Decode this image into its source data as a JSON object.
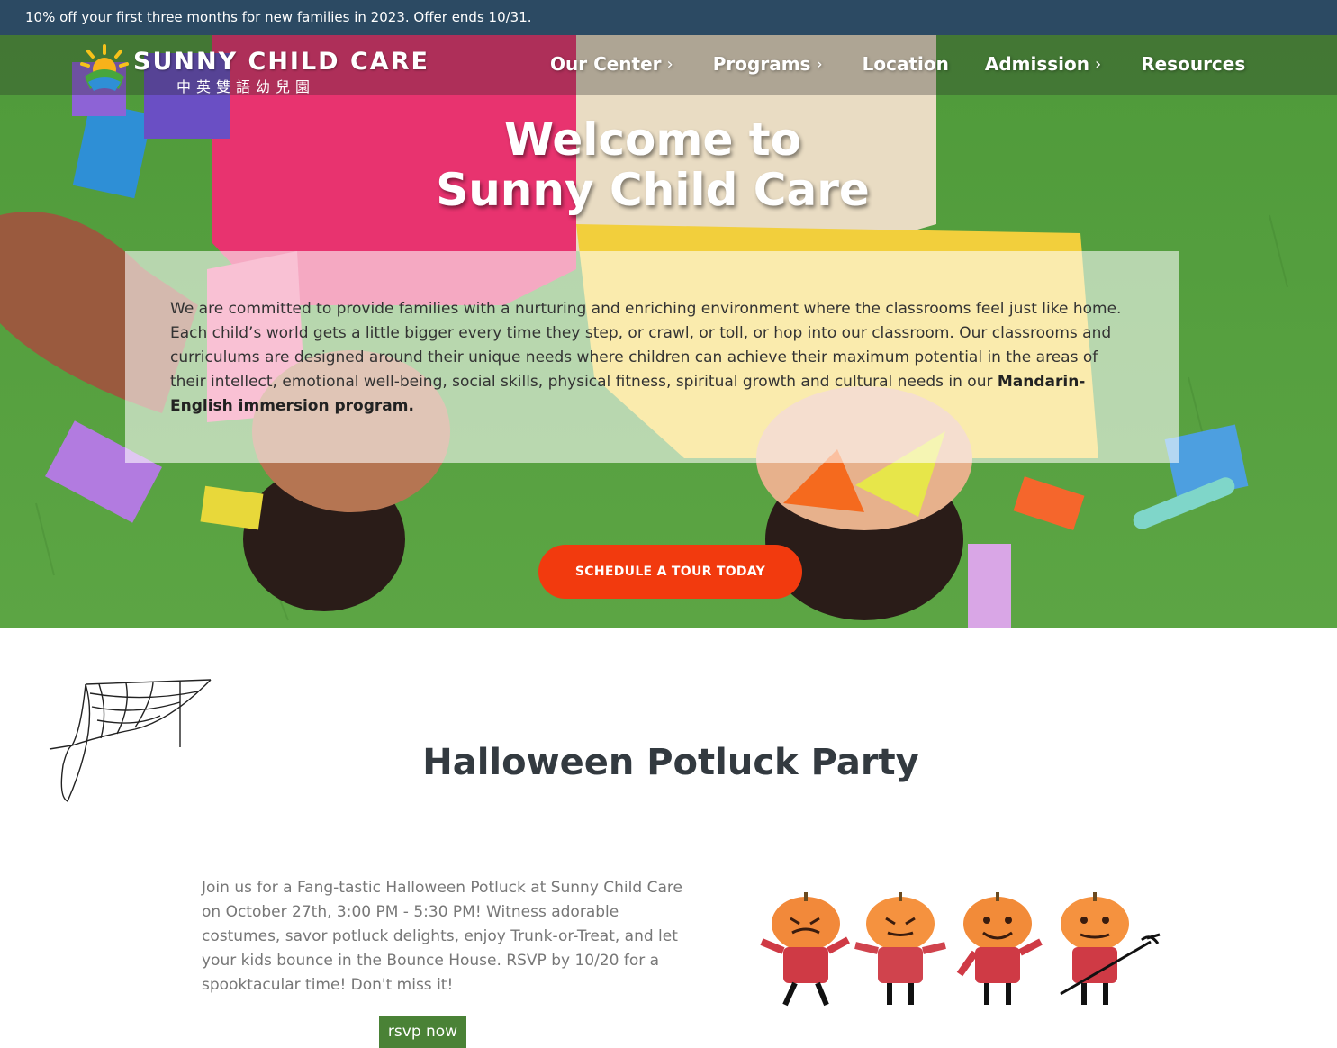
{
  "announcement": "10% off your first three months for new families in 2023. Offer ends 10/31.",
  "brand": {
    "name": "SUNNY CHILD CARE",
    "subtitle": "中英雙語幼兒園"
  },
  "nav": {
    "items": [
      {
        "label": "Our Center",
        "has_submenu": true
      },
      {
        "label": "Programs",
        "has_submenu": true
      },
      {
        "label": "Location",
        "has_submenu": false
      },
      {
        "label": "Admission",
        "has_submenu": true
      },
      {
        "label": "Resources",
        "has_submenu": false
      }
    ],
    "chevron_icon": "chevron-right-icon"
  },
  "hero": {
    "title_line1": "Welcome to",
    "title_line2": "Sunny Child Care",
    "intro_text": "We are committed to provide families with a nurturing and enriching environment where the classrooms feel just like home. Each child’s world gets a little bigger every time they step, or crawl, or toll, or hop into our classroom. Our classrooms and curriculums are designed around their unique needs where children can achieve their maximum potential in the areas of their intellect, emotional well-being, social skills, physical fitness, spiritual growth and cultural needs in our ",
    "intro_emphasis": "Mandarin-English immersion program.",
    "cta_label": "SCHEDULE A TOUR TODAY"
  },
  "event": {
    "title": "Halloween Potluck Party",
    "description": "Join us for a Fang-tastic Halloween Potluck at Sunny Child Care on October 27th, 3:00 PM - 5:30 PM! Witness adorable costumes, savor potluck delights, enjoy Trunk-or-Treat, and let your kids bounce in the Bounce House. RSVP by 10/20 for a spooktacular time! Don't miss it!",
    "rsvp_label": "rsvp now"
  },
  "colors": {
    "announce_bg": "#2c4a63",
    "cta": "#f23a0e",
    "rsvp": "#4a8236",
    "title_text": "#333a40"
  }
}
